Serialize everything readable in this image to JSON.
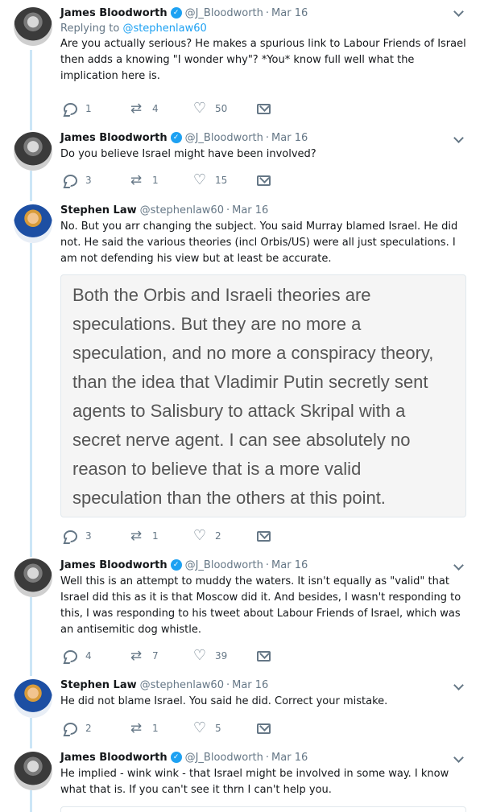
{
  "tweets": [
    {
      "name": "James Bloodworth",
      "handle": "@J_Bloodworth",
      "date": "Mar 16",
      "replying_label": "Replying to",
      "replying_handle": "@stephenlaw60",
      "text": "Are you actually serious? He makes a spurious link to Labour Friends of Israel then adds a knowing \"I wonder why\"? *You* know full well what the implication here is.",
      "replies": "1",
      "retweets": "4",
      "likes": "50"
    },
    {
      "name": "James Bloodworth",
      "handle": "@J_Bloodworth",
      "date": "Mar 16",
      "text": "Do you believe Israel might have been involved?",
      "replies": "3",
      "retweets": "1",
      "likes": "15"
    },
    {
      "name": "Stephen Law",
      "handle": "@stephenlaw60",
      "date": "Mar 16",
      "text": "No. But you arr changing the subject. You said Murray blamed Israel. He did not. He said the various theories (incl Orbis/US) were all just speculations. I am not defending his view but at least be accurate.",
      "quote": "Both the Orbis and Israeli theories are speculations. But they are no more a speculation, and no more a conspiracy theory, than the idea that Vladimir Putin secretly sent agents to Salisbury to attack Skripal with a secret nerve agent. I can see absolutely no reason to believe that is a more valid speculation than the others at this point.",
      "replies": "3",
      "retweets": "1",
      "likes": "2"
    },
    {
      "name": "James Bloodworth",
      "handle": "@J_Bloodworth",
      "date": "Mar 16",
      "text": "Well this is an attempt to muddy the waters. It isn't equally as \"valid\" that Israel did this as it is that Moscow did it. And besides, I wasn't responding to this, I was responding to his tweet about Labour Friends of Israel, which was an antisemitic dog whistle.",
      "replies": "4",
      "retweets": "7",
      "likes": "39"
    },
    {
      "name": "Stephen Law",
      "handle": "@stephenlaw60",
      "date": "Mar 16",
      "text": "He did not blame Israel. You said he did. Correct your mistake.",
      "replies": "2",
      "retweets": "1",
      "likes": "5"
    },
    {
      "name": "James Bloodworth",
      "handle": "@J_Bloodworth",
      "date": "Mar 16",
      "text": "He implied - wink wink - that Israel might be involved in some way. I know what that is. If you can't see it thrn I can't help you."
    }
  ],
  "icons": {
    "verified": "verified-badge-icon",
    "reply": "reply-icon",
    "retweet": "retweet-icon",
    "like": "heart-icon",
    "dm": "envelope-icon",
    "more": "chevron-down-icon"
  },
  "colors": {
    "accent": "#1da1f2",
    "thread": "#cce6f7",
    "muted": "#657786"
  }
}
